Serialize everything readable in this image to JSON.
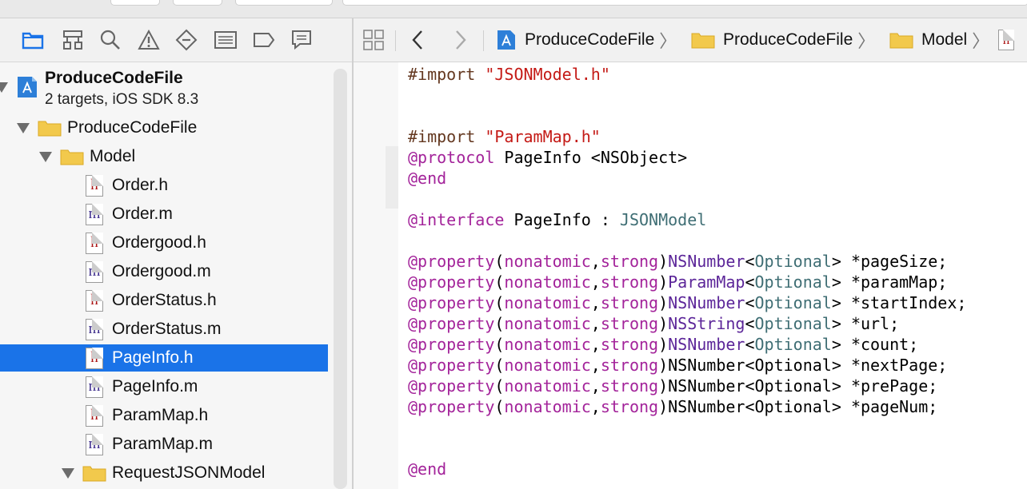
{
  "navigator": {
    "icons": [
      "folder-icon",
      "hierarchy-icon",
      "search-icon",
      "warning-icon",
      "diamond-icon",
      "list-icon",
      "tag-icon",
      "comment-icon"
    ],
    "project": {
      "name": "ProduceCodeFile",
      "subtitle": "2 targets, iOS SDK 8.3"
    },
    "groups": {
      "main": "ProduceCodeFile",
      "model": "Model",
      "request": "RequestJSONModel"
    },
    "files": [
      {
        "name": "Order.h",
        "kind": "h"
      },
      {
        "name": "Order.m",
        "kind": "m"
      },
      {
        "name": "Ordergood.h",
        "kind": "h"
      },
      {
        "name": "Ordergood.m",
        "kind": "m"
      },
      {
        "name": "OrderStatus.h",
        "kind": "h"
      },
      {
        "name": "OrderStatus.m",
        "kind": "m"
      },
      {
        "name": "PageInfo.h",
        "kind": "h",
        "selected": true
      },
      {
        "name": "PageInfo.m",
        "kind": "m"
      },
      {
        "name": "ParamMap.h",
        "kind": "h"
      },
      {
        "name": "ParamMap.m",
        "kind": "m"
      }
    ]
  },
  "jumpbar": {
    "crumbs": [
      "ProduceCodeFile",
      "ProduceCodeFile",
      "Model"
    ],
    "file_glyph": "h"
  },
  "code": {
    "import1": "#import \"JSONModel.h\"",
    "import2": "#import \"ParamMap.h\"",
    "protocol_kw": "@protocol",
    "protocol_rest": " PageInfo <NSObject>",
    "end_kw": "@end",
    "interface_kw": "@interface",
    "interface_mid": " PageInfo : ",
    "interface_super": "JSONModel",
    "properties": [
      {
        "type": "NSNumber",
        "name": "*pageSize;",
        "colored": true
      },
      {
        "type": "ParamMap",
        "name": "*paramMap;",
        "colored": true
      },
      {
        "type": "NSNumber",
        "name": "*startIndex;",
        "colored": true
      },
      {
        "type": "NSString",
        "name": "*url;",
        "colored": true
      },
      {
        "type": "NSNumber",
        "name": "*count;",
        "colored": true
      },
      {
        "type": "NSNumber",
        "name": "*nextPage;",
        "colored": false
      },
      {
        "type": "NSNumber",
        "name": "*prePage;",
        "colored": false
      },
      {
        "type": "NSNumber",
        "name": "*pageNum;",
        "colored": false
      }
    ],
    "prop_kw": "@property",
    "prop_attrs_open": "(",
    "prop_attr1": "nonatomic",
    "prop_comma": ",",
    "prop_attr2": "strong",
    "prop_attrs_close": ")",
    "optional": "Optional",
    "end_kw2": "@end"
  },
  "colors": {
    "selection": "#1a73e8",
    "keyword": "#a3239a",
    "string": "#c41a16",
    "class": "#3f6e74",
    "type": "#5c2699"
  }
}
